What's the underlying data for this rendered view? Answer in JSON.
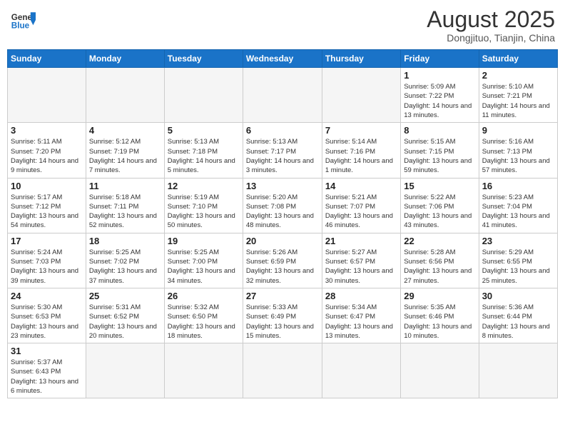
{
  "header": {
    "logo_general": "General",
    "logo_blue": "Blue",
    "month_title": "August 2025",
    "location": "Dongjituo, Tianjin, China"
  },
  "weekdays": [
    "Sunday",
    "Monday",
    "Tuesday",
    "Wednesday",
    "Thursday",
    "Friday",
    "Saturday"
  ],
  "weeks": [
    [
      {
        "day": "",
        "info": ""
      },
      {
        "day": "",
        "info": ""
      },
      {
        "day": "",
        "info": ""
      },
      {
        "day": "",
        "info": ""
      },
      {
        "day": "",
        "info": ""
      },
      {
        "day": "1",
        "info": "Sunrise: 5:09 AM\nSunset: 7:22 PM\nDaylight: 14 hours and 13 minutes."
      },
      {
        "day": "2",
        "info": "Sunrise: 5:10 AM\nSunset: 7:21 PM\nDaylight: 14 hours and 11 minutes."
      }
    ],
    [
      {
        "day": "3",
        "info": "Sunrise: 5:11 AM\nSunset: 7:20 PM\nDaylight: 14 hours and 9 minutes."
      },
      {
        "day": "4",
        "info": "Sunrise: 5:12 AM\nSunset: 7:19 PM\nDaylight: 14 hours and 7 minutes."
      },
      {
        "day": "5",
        "info": "Sunrise: 5:13 AM\nSunset: 7:18 PM\nDaylight: 14 hours and 5 minutes."
      },
      {
        "day": "6",
        "info": "Sunrise: 5:13 AM\nSunset: 7:17 PM\nDaylight: 14 hours and 3 minutes."
      },
      {
        "day": "7",
        "info": "Sunrise: 5:14 AM\nSunset: 7:16 PM\nDaylight: 14 hours and 1 minute."
      },
      {
        "day": "8",
        "info": "Sunrise: 5:15 AM\nSunset: 7:15 PM\nDaylight: 13 hours and 59 minutes."
      },
      {
        "day": "9",
        "info": "Sunrise: 5:16 AM\nSunset: 7:13 PM\nDaylight: 13 hours and 57 minutes."
      }
    ],
    [
      {
        "day": "10",
        "info": "Sunrise: 5:17 AM\nSunset: 7:12 PM\nDaylight: 13 hours and 54 minutes."
      },
      {
        "day": "11",
        "info": "Sunrise: 5:18 AM\nSunset: 7:11 PM\nDaylight: 13 hours and 52 minutes."
      },
      {
        "day": "12",
        "info": "Sunrise: 5:19 AM\nSunset: 7:10 PM\nDaylight: 13 hours and 50 minutes."
      },
      {
        "day": "13",
        "info": "Sunrise: 5:20 AM\nSunset: 7:08 PM\nDaylight: 13 hours and 48 minutes."
      },
      {
        "day": "14",
        "info": "Sunrise: 5:21 AM\nSunset: 7:07 PM\nDaylight: 13 hours and 46 minutes."
      },
      {
        "day": "15",
        "info": "Sunrise: 5:22 AM\nSunset: 7:06 PM\nDaylight: 13 hours and 43 minutes."
      },
      {
        "day": "16",
        "info": "Sunrise: 5:23 AM\nSunset: 7:04 PM\nDaylight: 13 hours and 41 minutes."
      }
    ],
    [
      {
        "day": "17",
        "info": "Sunrise: 5:24 AM\nSunset: 7:03 PM\nDaylight: 13 hours and 39 minutes."
      },
      {
        "day": "18",
        "info": "Sunrise: 5:25 AM\nSunset: 7:02 PM\nDaylight: 13 hours and 37 minutes."
      },
      {
        "day": "19",
        "info": "Sunrise: 5:25 AM\nSunset: 7:00 PM\nDaylight: 13 hours and 34 minutes."
      },
      {
        "day": "20",
        "info": "Sunrise: 5:26 AM\nSunset: 6:59 PM\nDaylight: 13 hours and 32 minutes."
      },
      {
        "day": "21",
        "info": "Sunrise: 5:27 AM\nSunset: 6:57 PM\nDaylight: 13 hours and 30 minutes."
      },
      {
        "day": "22",
        "info": "Sunrise: 5:28 AM\nSunset: 6:56 PM\nDaylight: 13 hours and 27 minutes."
      },
      {
        "day": "23",
        "info": "Sunrise: 5:29 AM\nSunset: 6:55 PM\nDaylight: 13 hours and 25 minutes."
      }
    ],
    [
      {
        "day": "24",
        "info": "Sunrise: 5:30 AM\nSunset: 6:53 PM\nDaylight: 13 hours and 23 minutes."
      },
      {
        "day": "25",
        "info": "Sunrise: 5:31 AM\nSunset: 6:52 PM\nDaylight: 13 hours and 20 minutes."
      },
      {
        "day": "26",
        "info": "Sunrise: 5:32 AM\nSunset: 6:50 PM\nDaylight: 13 hours and 18 minutes."
      },
      {
        "day": "27",
        "info": "Sunrise: 5:33 AM\nSunset: 6:49 PM\nDaylight: 13 hours and 15 minutes."
      },
      {
        "day": "28",
        "info": "Sunrise: 5:34 AM\nSunset: 6:47 PM\nDaylight: 13 hours and 13 minutes."
      },
      {
        "day": "29",
        "info": "Sunrise: 5:35 AM\nSunset: 6:46 PM\nDaylight: 13 hours and 10 minutes."
      },
      {
        "day": "30",
        "info": "Sunrise: 5:36 AM\nSunset: 6:44 PM\nDaylight: 13 hours and 8 minutes."
      }
    ],
    [
      {
        "day": "31",
        "info": "Sunrise: 5:37 AM\nSunset: 6:43 PM\nDaylight: 13 hours and 6 minutes."
      },
      {
        "day": "",
        "info": ""
      },
      {
        "day": "",
        "info": ""
      },
      {
        "day": "",
        "info": ""
      },
      {
        "day": "",
        "info": ""
      },
      {
        "day": "",
        "info": ""
      },
      {
        "day": "",
        "info": ""
      }
    ]
  ]
}
